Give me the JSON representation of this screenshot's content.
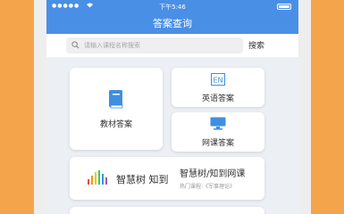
{
  "status_bar": {
    "carrier": "●●●●●",
    "time": "下午5:46"
  },
  "navbar": {
    "title": "答案查询"
  },
  "search": {
    "placeholder": "请输入课程名称搜索",
    "button_label": "搜索"
  },
  "cards": {
    "textbook": {
      "label": "教材答案",
      "icon": "book-icon"
    },
    "english": {
      "label": "英语答案",
      "icon": "en-icon",
      "icon_text": "EN"
    },
    "course": {
      "label": "网课答案",
      "icon": "monitor-icon"
    },
    "zhihuishu": {
      "logo_text": "智慧树 知到",
      "title": "智慧树/知到网课",
      "subtitle": "热门课程:《军事理论》"
    }
  },
  "colors": {
    "background": "#f4a54c",
    "brand_blue": "#4a8fe6",
    "card": "#ffffff"
  }
}
